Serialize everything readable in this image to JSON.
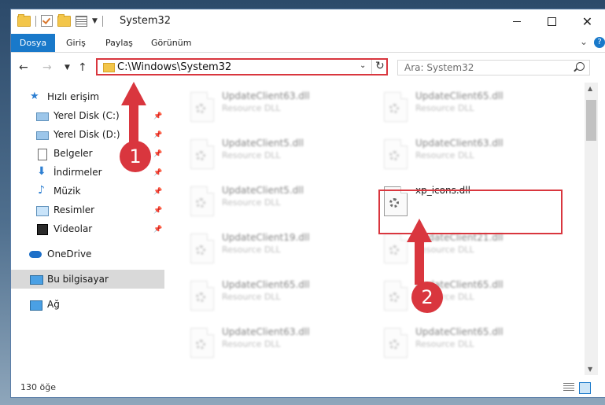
{
  "window": {
    "title": "System32",
    "colors": {
      "accent": "#1979ca",
      "highlight": "#d9363e",
      "selected_bg": "#d9d9d9"
    }
  },
  "ribbon": {
    "tabs": [
      "Dosya",
      "Giriş",
      "Paylaş",
      "Görünüm"
    ]
  },
  "address": {
    "path": "C:\\Windows\\System32",
    "search_placeholder": "Ara: System32"
  },
  "sidebar": {
    "items": [
      {
        "label": "Hızlı erişim",
        "icon": "star-icon"
      },
      {
        "label": "Yerel Disk (C:)",
        "icon": "drive-icon",
        "pinned": true
      },
      {
        "label": "Yerel Disk (D:)",
        "icon": "drive-icon",
        "pinned": true
      },
      {
        "label": "Belgeler",
        "icon": "document-icon",
        "pinned": true
      },
      {
        "label": "İndirmeler",
        "icon": "download-icon",
        "pinned": true
      },
      {
        "label": "Müzik",
        "icon": "music-icon",
        "pinned": true
      },
      {
        "label": "Resimler",
        "icon": "pictures-icon",
        "pinned": true
      },
      {
        "label": "Videolar",
        "icon": "video-icon",
        "pinned": true
      },
      {
        "label": "OneDrive",
        "icon": "cloud-icon"
      },
      {
        "label": "Bu bilgisayar",
        "icon": "computer-icon",
        "selected": true
      },
      {
        "label": "Ağ",
        "icon": "network-icon"
      }
    ]
  },
  "files": {
    "type_label": "Resource DLL",
    "left": [
      "UpdateClient63.dll",
      "UpdateClient5.dll",
      "UpdateClient5.dll",
      "UpdateClient19.dll",
      "UpdateClient65.dll",
      "UpdateClient63.dll"
    ],
    "right": [
      "UpdateClient65.dll",
      "UpdateClient63.dll",
      "xp_icons.dll",
      "UpdateClient21.dll",
      "UpdateClient65.dll",
      "UpdateClient65.dll"
    ],
    "highlighted": "xp_icons.dll"
  },
  "status": {
    "count": "130 öğe"
  },
  "annotations": {
    "step1": "1",
    "step2": "2"
  }
}
